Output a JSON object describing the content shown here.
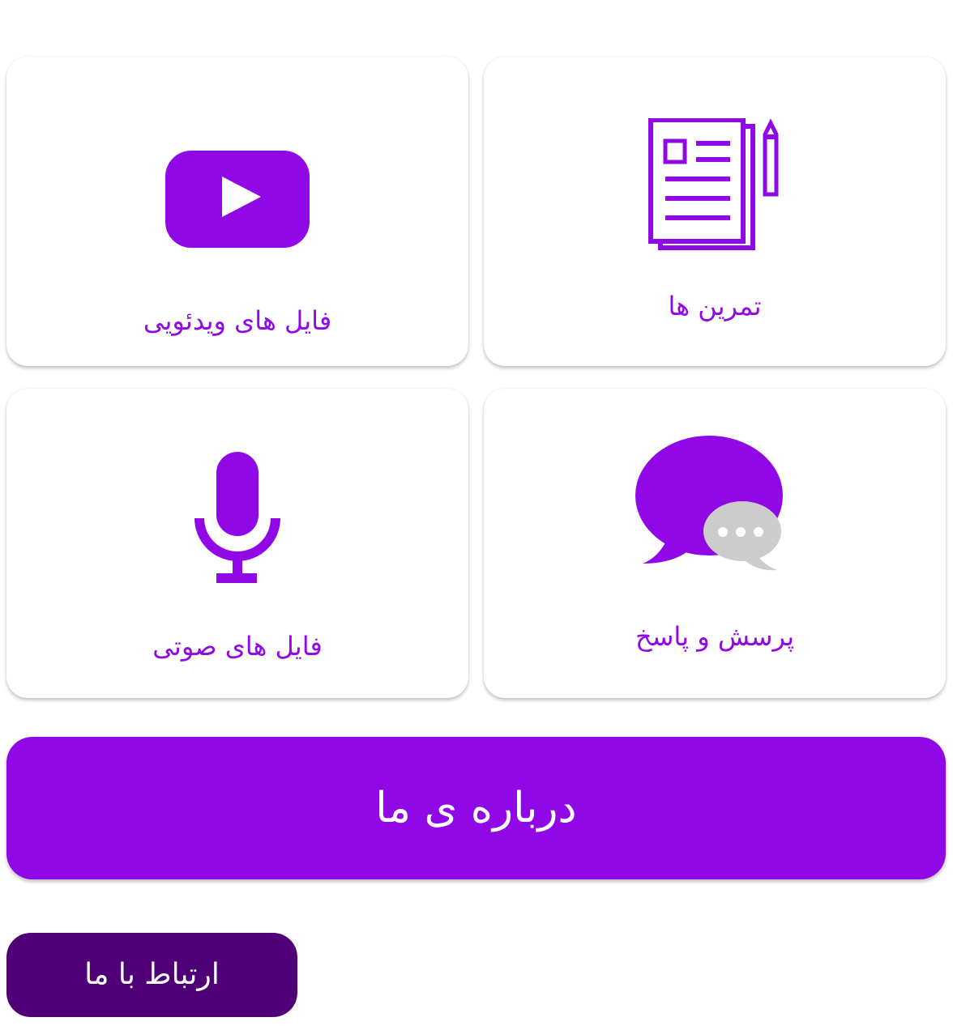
{
  "cards": [
    {
      "id": "exercises",
      "label": "تمرین ها",
      "icon": "document-pencil-icon"
    },
    {
      "id": "videos",
      "label": "فایل های ویدئویی",
      "icon": "youtube-play-icon"
    },
    {
      "id": "qa",
      "label": "پرسش و پاسخ",
      "icon": "chat-bubbles-icon"
    },
    {
      "id": "audio",
      "label": "فایل های صوتی",
      "icon": "microphone-icon"
    }
  ],
  "buttons": {
    "about_label": "درباره ی ما",
    "contact_label": "ارتباط با ما"
  },
  "colors": {
    "accent": "#9108e6",
    "contact_bg": "#4f0077",
    "bubble_gray": "#cccccc",
    "card_bg": "#ffffff"
  }
}
